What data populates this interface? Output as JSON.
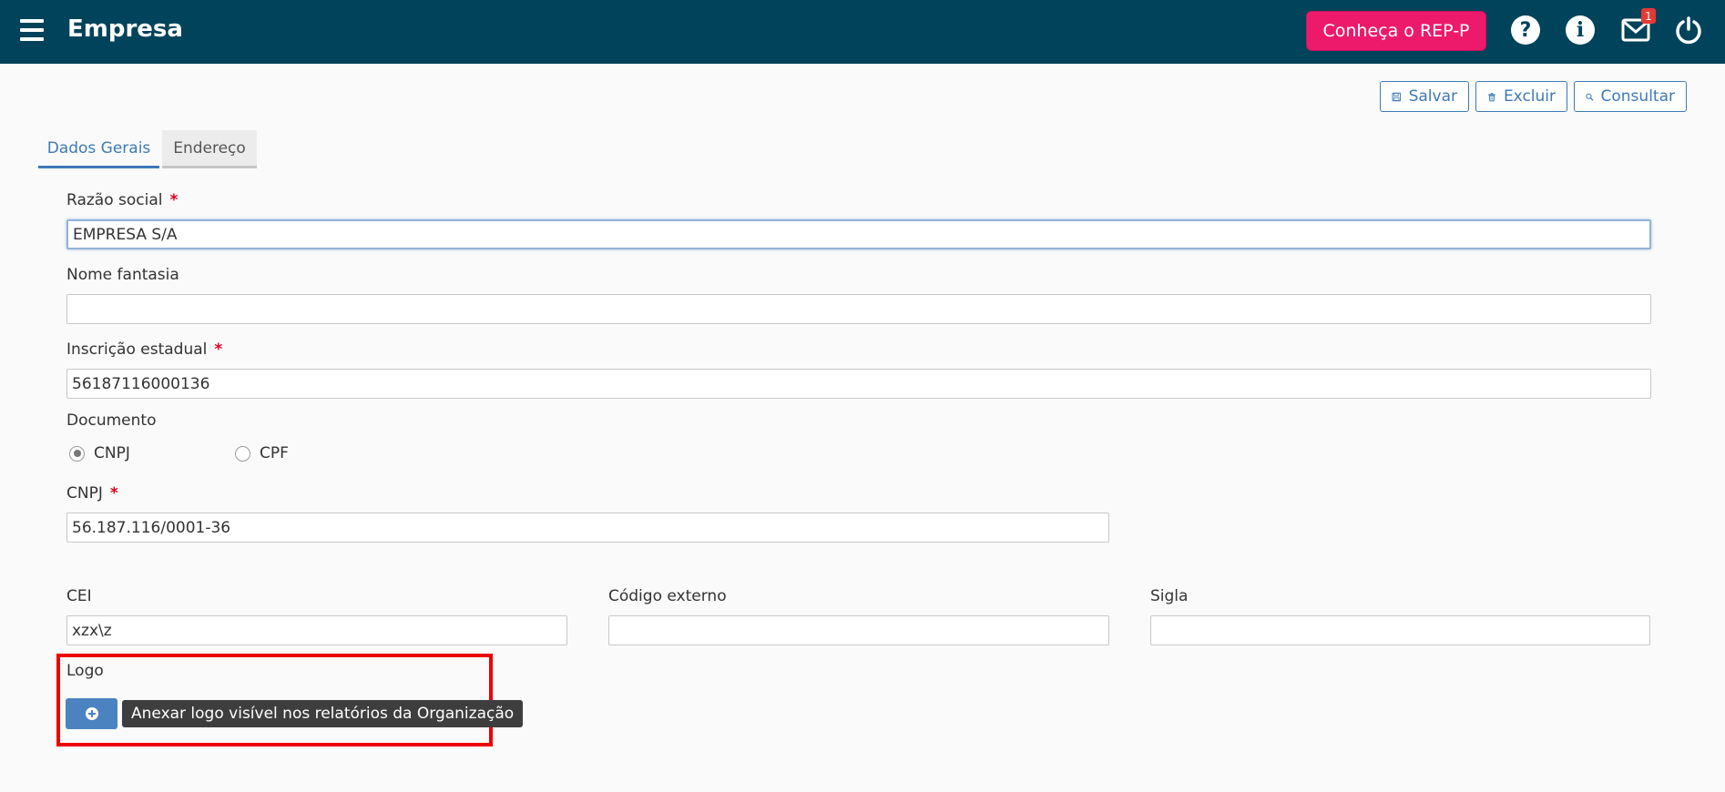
{
  "header": {
    "title": "Empresa",
    "rep_button": "Conheça o REP-P",
    "help_icon_glyph": "?",
    "info_icon_glyph": "i",
    "notification_count": "1",
    "background_color": "#00435a",
    "accent_color": "#ed1a6b"
  },
  "toolbar": {
    "save_label": "Salvar",
    "delete_label": "Excluir",
    "search_label": "Consultar"
  },
  "tabs": [
    {
      "label": "Dados Gerais",
      "active": true
    },
    {
      "label": "Endereço",
      "active": false
    }
  ],
  "form": {
    "razao_social": {
      "label": "Razão social",
      "required_mark": "*",
      "value": "EMPRESA S/A"
    },
    "nome_fantasia": {
      "label": "Nome fantasia",
      "value": ""
    },
    "inscricao_estadual": {
      "label": "Inscrição estadual",
      "required_mark": "*",
      "value": "56187116000136"
    },
    "documento": {
      "label": "Documento",
      "options": [
        {
          "label": "CNPJ",
          "checked": true
        },
        {
          "label": "CPF",
          "checked": false
        }
      ]
    },
    "cnpj": {
      "label": "CNPJ",
      "required_mark": "*",
      "value": "56.187.116/0001-36"
    },
    "cei": {
      "label": "CEI",
      "value": "xzx\\z"
    },
    "codigo_externo": {
      "label": "Código externo",
      "value": ""
    },
    "sigla": {
      "label": "Sigla",
      "value": ""
    },
    "logo": {
      "label": "Logo",
      "add_icon": "plus-circle-icon",
      "tooltip": "Anexar logo visível nos relatórios da Organização"
    }
  }
}
